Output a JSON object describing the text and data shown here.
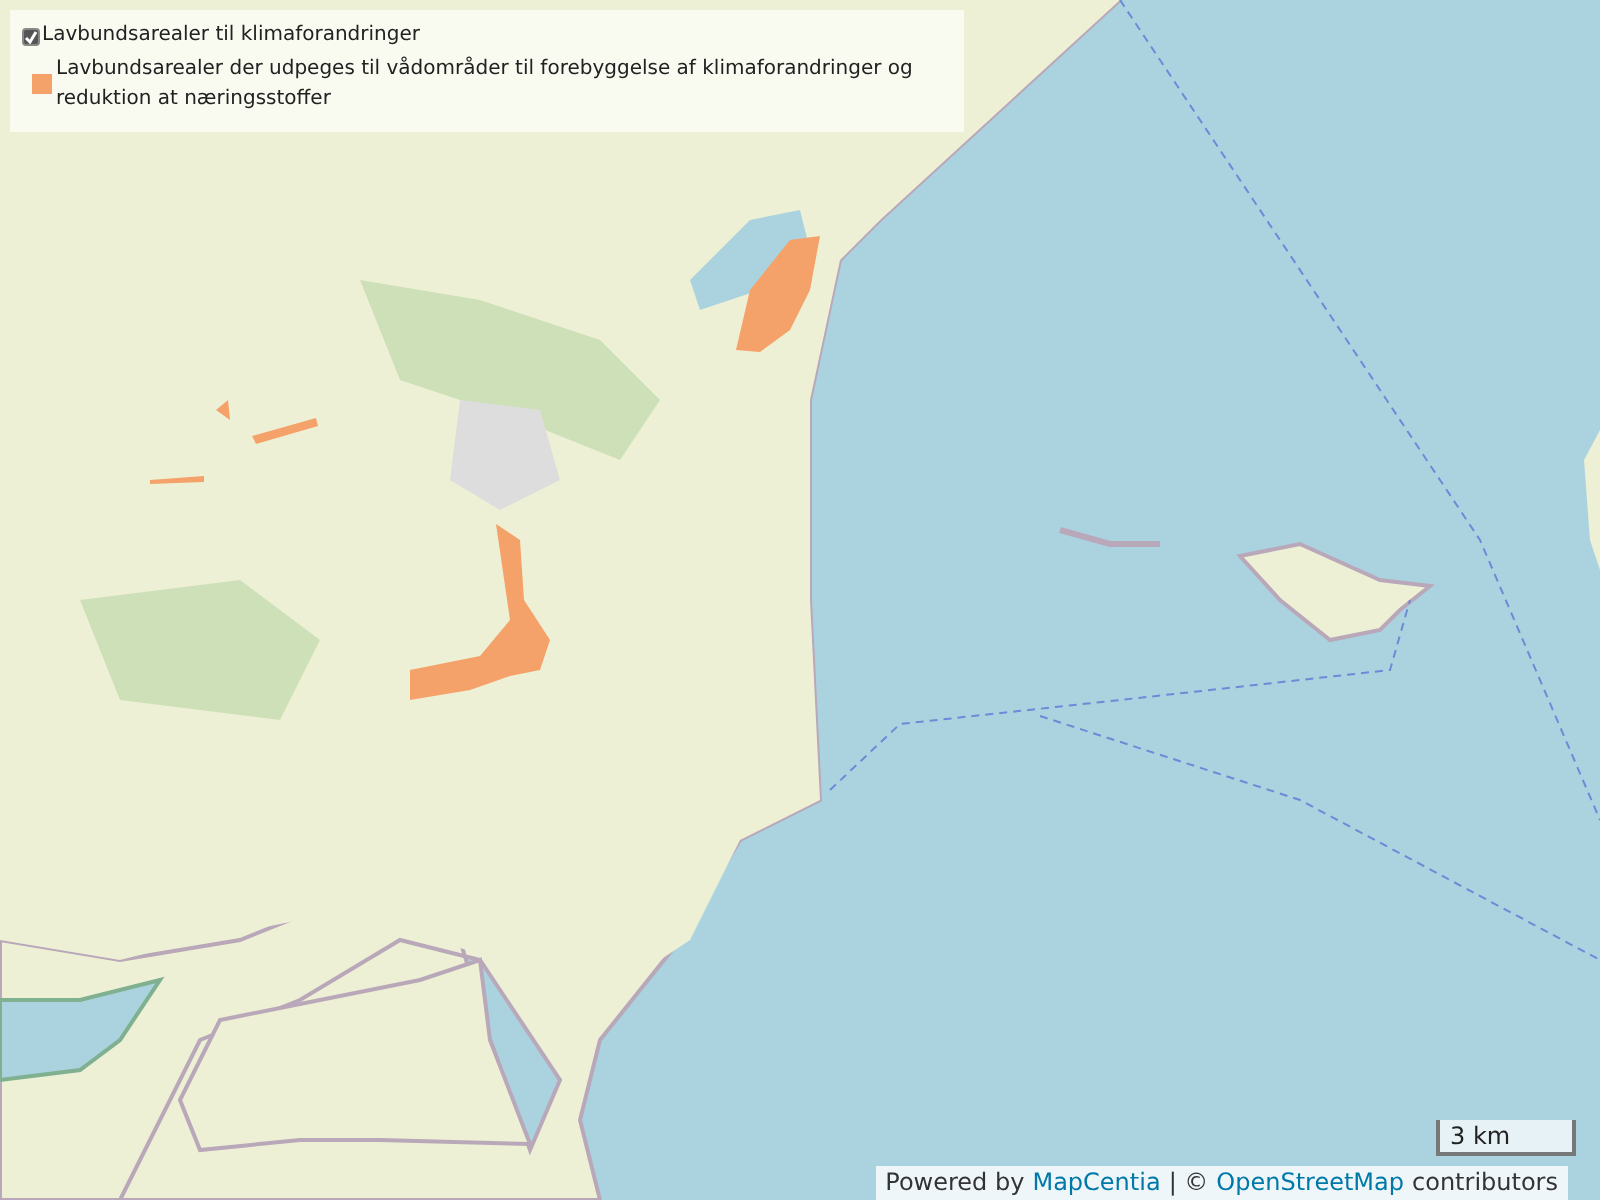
{
  "legend": {
    "layer": {
      "label": "Lavbundsarealer til klimaforandringer",
      "checked": true
    },
    "items": [
      {
        "label": "Lavbundsarealer der udpeges til vådområder til forebyggelse af klimaforandringer og reduktion at næringsstoffer",
        "color": "#f4a26a"
      }
    ]
  },
  "scale": {
    "label": "3 km"
  },
  "attribution": {
    "prefix": "Powered by",
    "link_1": "MapCentia",
    "separator": "| ©",
    "link_2": "OpenStreetMap",
    "suffix": "contributors"
  }
}
